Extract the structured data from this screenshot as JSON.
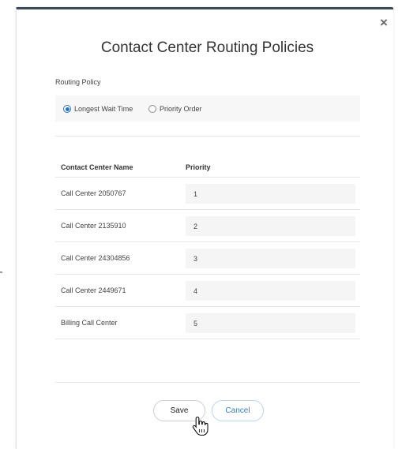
{
  "dialog": {
    "title": "Contact Center Routing Policies",
    "close_glyph": "×",
    "close_icon": "close-icon"
  },
  "routing_policy": {
    "label": "Routing Policy",
    "options": [
      {
        "label": "Longest Wait Time",
        "checked": true
      },
      {
        "label": "Priority Order",
        "checked": false
      }
    ]
  },
  "table": {
    "headers": [
      "Contact Center Name",
      "Priority"
    ],
    "rows": [
      {
        "name": "Call Center 2050767",
        "priority": "1"
      },
      {
        "name": "Call Center 2135910",
        "priority": "2"
      },
      {
        "name": "Call Center 24304856",
        "priority": "3"
      },
      {
        "name": "Call Center 2449671",
        "priority": "4"
      },
      {
        "name": "Billing Call Center",
        "priority": "5"
      }
    ]
  },
  "buttons": {
    "save": "Save",
    "cancel": "Cancel"
  },
  "colors": {
    "accent": "#1e73d8",
    "cancel_text": "#2f7fd6",
    "top_bar": "#3f4a59"
  },
  "cursor": "hand-pointer-icon"
}
